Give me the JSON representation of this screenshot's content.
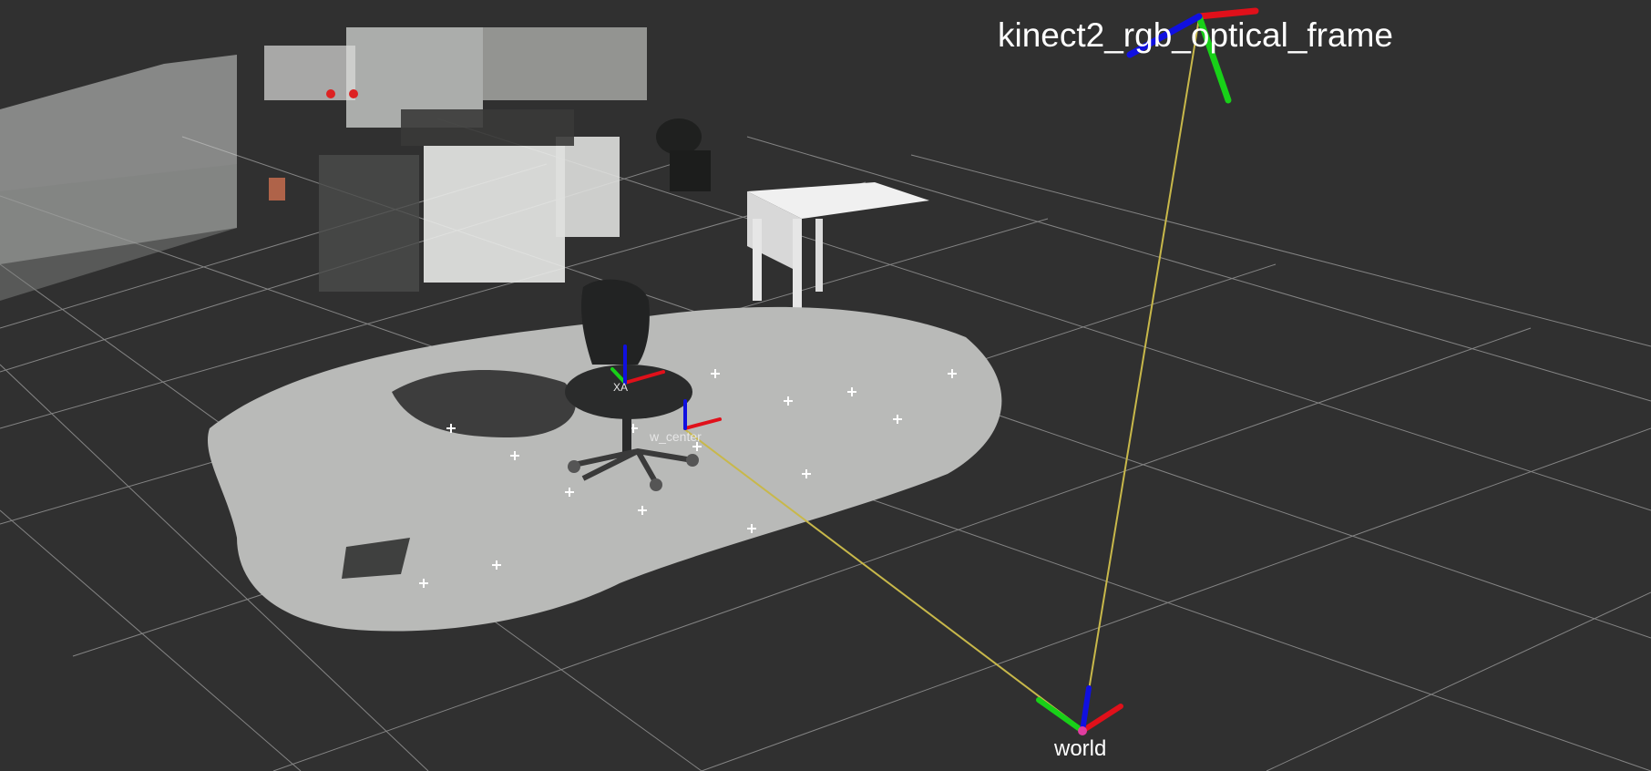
{
  "viewport": {
    "background": "#303030",
    "grid_color": "#a0a0a0"
  },
  "frames": {
    "camera": {
      "label": "kinect2_rgb_optical_frame",
      "icon": "axes-triad"
    },
    "world": {
      "label": "world",
      "icon": "axes-triad"
    },
    "chair_center": {
      "label": "w_center",
      "icon": "axes-triad"
    },
    "chair_top": {
      "label": "XA",
      "icon": "axes-triad"
    }
  },
  "axis_colors": {
    "x": "#e0101a",
    "y": "#18d018",
    "z": "#1010e0"
  },
  "link_color": "#c8b84a"
}
